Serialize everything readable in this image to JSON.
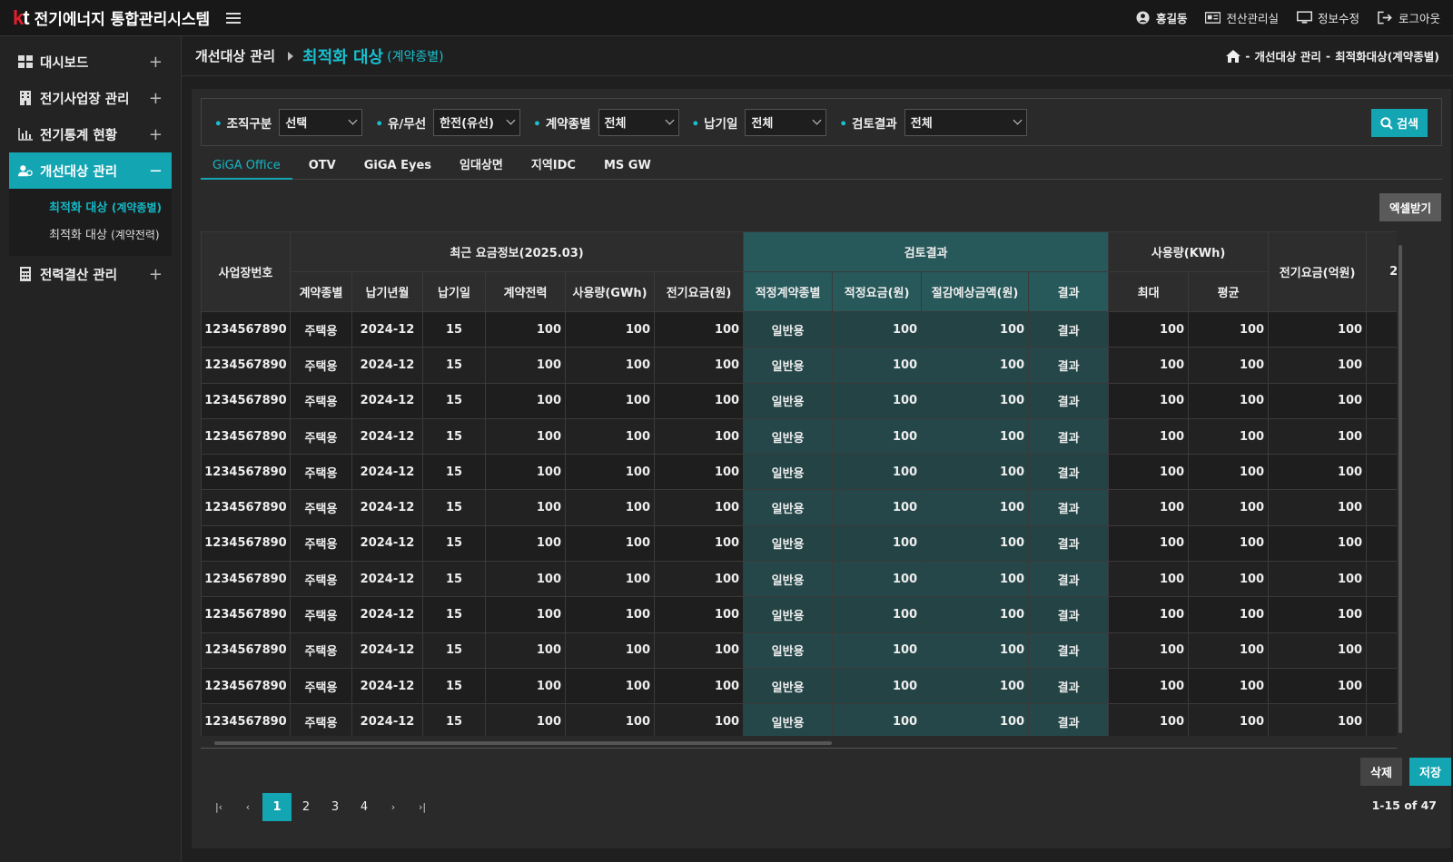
{
  "app": {
    "logo": "kt",
    "title": "전기에너지 통합관리시스템"
  },
  "topnav": {
    "user": "홍길동",
    "items": [
      "전산관리실",
      "정보수정",
      "로그아웃"
    ]
  },
  "sidebar": {
    "items": [
      {
        "label": "대시보드"
      },
      {
        "label": "전기사업장 관리"
      },
      {
        "label": "전기통계 현황"
      },
      {
        "label": "개선대상 관리"
      },
      {
        "label": "전력결산 관리"
      }
    ],
    "submenu": [
      {
        "label": "최적화 대상",
        "sub": "(계약종별)"
      },
      {
        "label": "최적화 대상",
        "sub": "(계약전력)"
      }
    ]
  },
  "crumb": {
    "section": "개선대상 관리",
    "page": "최적화 대상",
    "page_sub": "(계약종별)",
    "path": [
      "개선대상 관리",
      "최적화대상(계약종별)"
    ]
  },
  "filters": [
    {
      "label": "조직구분",
      "value": "선택"
    },
    {
      "label": "유/무선",
      "value": "한전(유선)"
    },
    {
      "label": "계약종별",
      "value": "전체"
    },
    {
      "label": "납기일",
      "value": "전체"
    },
    {
      "label": "검토결과",
      "value": "전체"
    }
  ],
  "buttons": {
    "search": "검색",
    "excel": "엑셀받기",
    "delete": "삭제",
    "save": "저장"
  },
  "tabs": [
    "GiGA Office",
    "OTV",
    "GiGA Eyes",
    "임대상면",
    "지역IDC",
    "MS GW"
  ],
  "table": {
    "groups": {
      "site": "사업장번호",
      "recent": "최근 요금정보(2025.03)",
      "review": "검토결과",
      "usage": "사용량(KWh)",
      "fee": "전기요금(억원)",
      "extra": "2"
    },
    "cols": [
      "계약종별",
      "납기년월",
      "납기일",
      "계약전력",
      "사용량(GWh)",
      "전기요금(원)",
      "적정계약종별",
      "적정요금(원)",
      "절감예상금액(원)",
      "결과",
      "최대",
      "평균"
    ],
    "rows": [
      [
        "1234567890",
        "주택용",
        "2024-12",
        "15",
        "100",
        "100",
        "100",
        "일반용",
        "100",
        "100",
        "결과",
        "100",
        "100",
        "100"
      ],
      [
        "1234567890",
        "주택용",
        "2024-12",
        "15",
        "100",
        "100",
        "100",
        "일반용",
        "100",
        "100",
        "결과",
        "100",
        "100",
        "100"
      ],
      [
        "1234567890",
        "주택용",
        "2024-12",
        "15",
        "100",
        "100",
        "100",
        "일반용",
        "100",
        "100",
        "결과",
        "100",
        "100",
        "100"
      ],
      [
        "1234567890",
        "주택용",
        "2024-12",
        "15",
        "100",
        "100",
        "100",
        "일반용",
        "100",
        "100",
        "결과",
        "100",
        "100",
        "100"
      ],
      [
        "1234567890",
        "주택용",
        "2024-12",
        "15",
        "100",
        "100",
        "100",
        "일반용",
        "100",
        "100",
        "결과",
        "100",
        "100",
        "100"
      ],
      [
        "1234567890",
        "주택용",
        "2024-12",
        "15",
        "100",
        "100",
        "100",
        "일반용",
        "100",
        "100",
        "결과",
        "100",
        "100",
        "100"
      ],
      [
        "1234567890",
        "주택용",
        "2024-12",
        "15",
        "100",
        "100",
        "100",
        "일반용",
        "100",
        "100",
        "결과",
        "100",
        "100",
        "100"
      ],
      [
        "1234567890",
        "주택용",
        "2024-12",
        "15",
        "100",
        "100",
        "100",
        "일반용",
        "100",
        "100",
        "결과",
        "100",
        "100",
        "100"
      ],
      [
        "1234567890",
        "주택용",
        "2024-12",
        "15",
        "100",
        "100",
        "100",
        "일반용",
        "100",
        "100",
        "결과",
        "100",
        "100",
        "100"
      ],
      [
        "1234567890",
        "주택용",
        "2024-12",
        "15",
        "100",
        "100",
        "100",
        "일반용",
        "100",
        "100",
        "결과",
        "100",
        "100",
        "100"
      ],
      [
        "1234567890",
        "주택용",
        "2024-12",
        "15",
        "100",
        "100",
        "100",
        "일반용",
        "100",
        "100",
        "결과",
        "100",
        "100",
        "100"
      ],
      [
        "1234567890",
        "주택용",
        "2024-12",
        "15",
        "100",
        "100",
        "100",
        "일반용",
        "100",
        "100",
        "결과",
        "100",
        "100",
        "100"
      ]
    ]
  },
  "pagination": {
    "pages": [
      "1",
      "2",
      "3",
      "4"
    ],
    "current": "1",
    "count": "1-15 of 47"
  },
  "colors": {
    "accent": "#14a5b3",
    "review_header": "#27585a",
    "brand_red": "#e61e2b"
  }
}
